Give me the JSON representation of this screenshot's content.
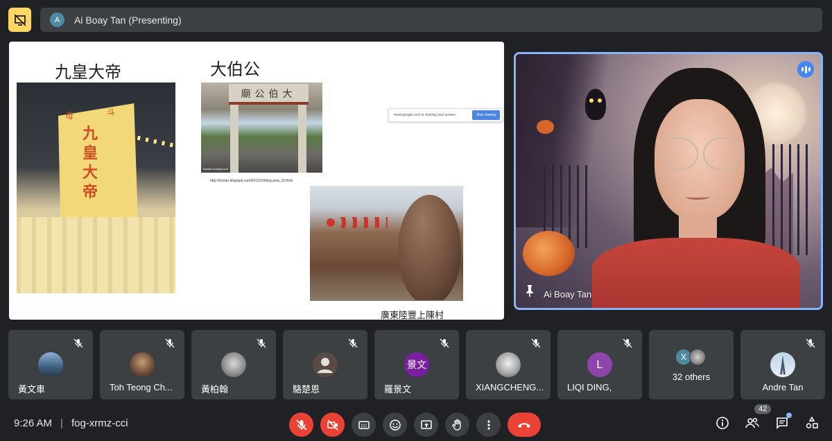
{
  "header": {
    "presenter_initial": "A",
    "presenter_label": "Ai Boay Tan (Presenting)"
  },
  "slide": {
    "title_left": "九皇大帝",
    "title_right": "大伯公",
    "sail_main": "九皇大帝",
    "sail_left": "母",
    "sail_right": "斗",
    "temple_gate_text": "廟公伯大",
    "temple_credit": "hacitan.multiply.com",
    "url": "http://hsctan.blogspot.com/2012/10/blog-post_15.html",
    "share_notice": {
      "text": "meet.google.com is sharing your screen.",
      "button": "Stop sharing"
    },
    "village_caption": "廣東陸豐上陳村"
  },
  "main_video": {
    "name": "Ai Boay Tan"
  },
  "participants": [
    {
      "name": "黃文車",
      "avatar_text": "",
      "avatar_color": "#6b8fb3"
    },
    {
      "name": "Toh Teong Ch...",
      "avatar_text": "",
      "avatar_color": "#8a6a4a"
    },
    {
      "name": "黃柏翰",
      "avatar_text": "",
      "avatar_color": "#9a9a9a"
    },
    {
      "name": "駱楚恩",
      "avatar_text": "",
      "avatar_color": "#5a4a44"
    },
    {
      "name": "羅景文",
      "avatar_text": "景文",
      "avatar_color": "#7b1fa2"
    },
    {
      "name": "XIANGCHENG...",
      "avatar_text": "",
      "avatar_color": "#cfcfcf"
    },
    {
      "name": "LIQI DING,",
      "avatar_text": "L",
      "avatar_color": "#8e44ad"
    }
  ],
  "others": {
    "label": "32 others",
    "first_initial": "X",
    "first_color": "#4f8ba0"
  },
  "last_participant": {
    "name": "Andre Tan"
  },
  "bottom": {
    "time": "9:26 AM",
    "meeting_code": "fog-xrmz-cci",
    "participant_count": "42"
  }
}
